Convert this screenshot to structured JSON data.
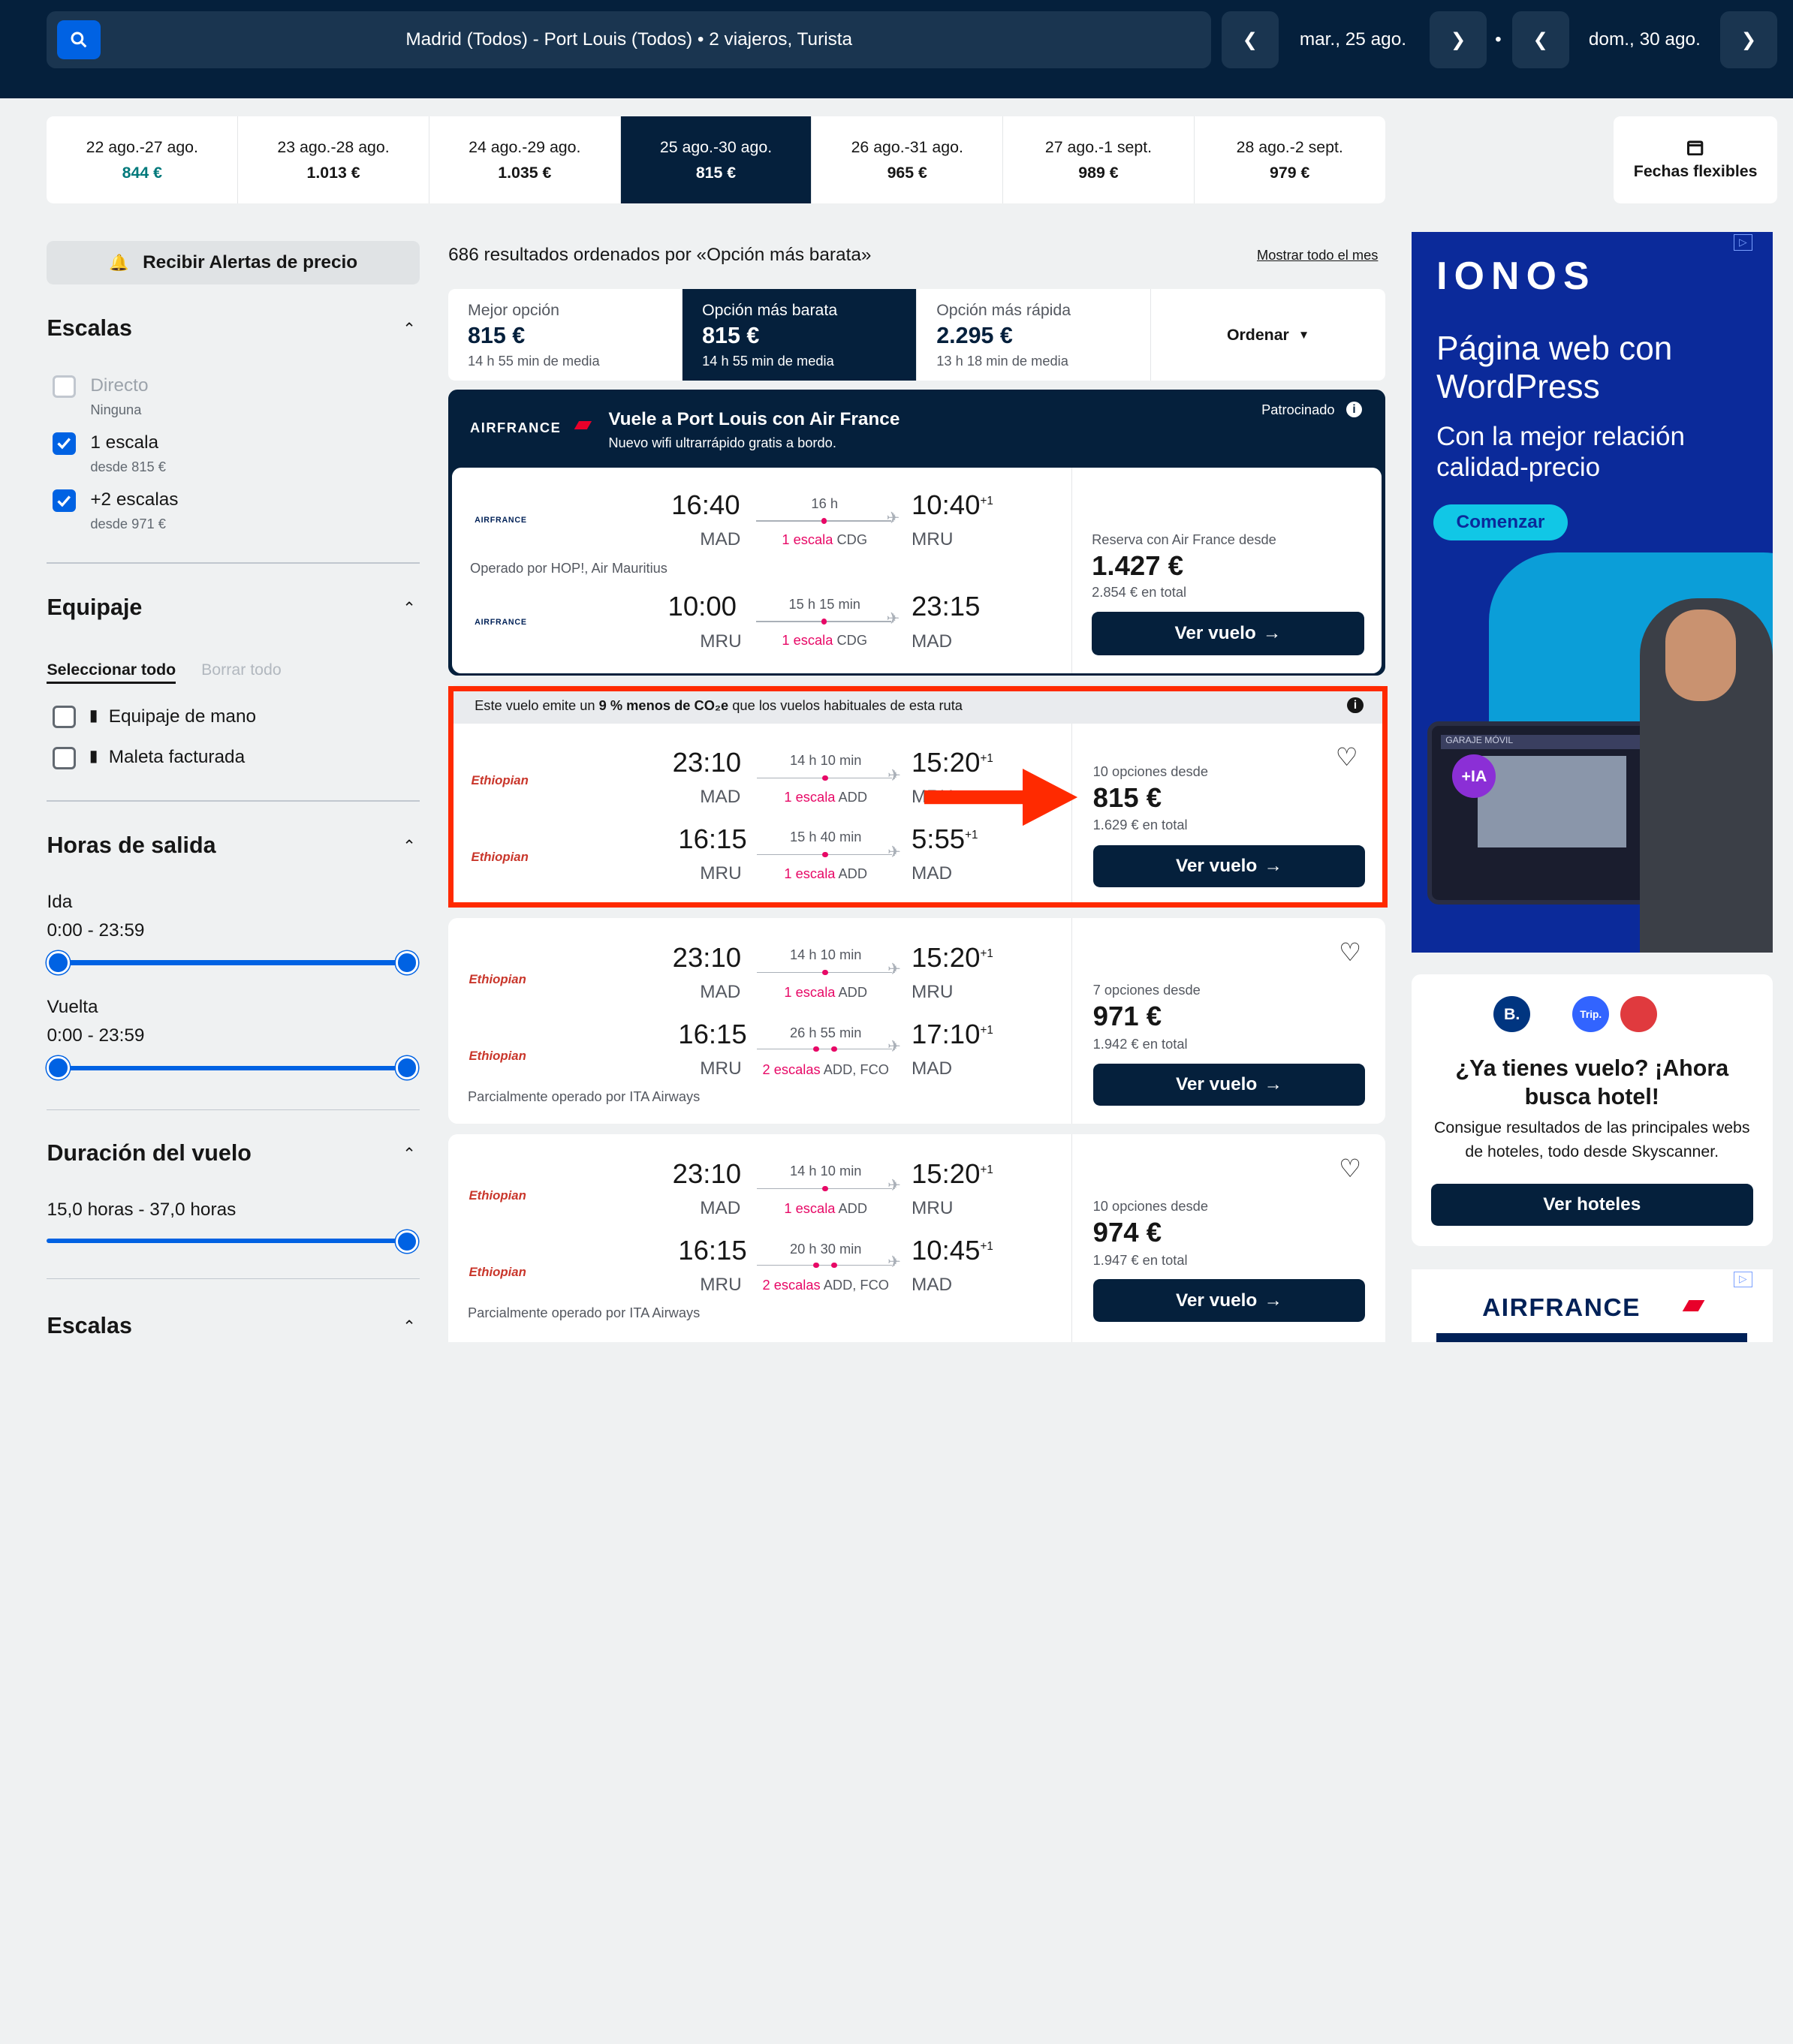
{
  "search": {
    "summary": "Madrid (Todos) - Port Louis (Todos)  •  2 viajeros, Turista",
    "depart": "mar., 25 ago.",
    "return": "dom., 30 ago.",
    "sep": "•"
  },
  "dates": [
    {
      "range": "22 ago.-27 ago.",
      "price": "844 €"
    },
    {
      "range": "23 ago.-28 ago.",
      "price": "1.013 €"
    },
    {
      "range": "24 ago.-29 ago.",
      "price": "1.035 €"
    },
    {
      "range": "25 ago.-30 ago.",
      "price": "815 €"
    },
    {
      "range": "26 ago.-31 ago.",
      "price": "965 €"
    },
    {
      "range": "27 ago.-1 sept.",
      "price": "989 €"
    },
    {
      "range": "28 ago.-2 sept.",
      "price": "979 €"
    }
  ],
  "flex_label": "Fechas flexibles",
  "sidebar": {
    "alert_label": "Recibir Alertas de precio",
    "stops_title": "Escalas",
    "stops": [
      {
        "label": "Directo",
        "sub": "Ninguna"
      },
      {
        "label": "1 escala",
        "sub": "desde 815 €"
      },
      {
        "label": "+2 escalas",
        "sub": "desde 971 €"
      }
    ],
    "bag_title": "Equipaje",
    "select_all": "Seleccionar todo",
    "clear_all": "Borrar todo",
    "bags": [
      "Equipaje de mano",
      "Maleta facturada"
    ],
    "times_title": "Horas de salida",
    "ida": "Ida",
    "ida_range": "0:00 - 23:59",
    "vuelta": "Vuelta",
    "vuelta_range": "0:00 - 23:59",
    "duration_title": "Duración del vuelo",
    "duration_range": "15,0 horas - 37,0 horas",
    "stops2_title": "Escalas"
  },
  "results": {
    "count_text": "686 resultados ordenados por «Opción más barata»",
    "show_month": "Mostrar todo el mes"
  },
  "sort": [
    {
      "title": "Mejor opción",
      "price": "815 €",
      "avg": "14 h 55 min de media"
    },
    {
      "title": "Opción más barata",
      "price": "815 €",
      "avg": "14 h 55 min de media"
    },
    {
      "title": "Opción más rápida",
      "price": "2.295 €",
      "avg": "13 h 18 min de media"
    }
  ],
  "sort_label": "Ordenar",
  "sponsored": {
    "brand": "AIRFRANCE",
    "title": "Vuele a Port Louis con Air France",
    "subtitle": "Nuevo wifi ultrarrápido gratis a bordo.",
    "tag": "Patrocinado",
    "out": {
      "dep": "16:40",
      "dep_ap": "MAD",
      "dur": "16 h",
      "stop": "1 escala",
      "stop_ap": "CDG",
      "arr": "10:40",
      "plus": "+1",
      "arr_ap": "MRU"
    },
    "operated": "Operado por HOP!, Air Mauritius",
    "ret": {
      "dep": "10:00",
      "dep_ap": "MRU",
      "dur": "15 h 15 min",
      "stop": "1 escala",
      "stop_ap": "CDG",
      "arr": "23:15",
      "plus": "",
      "arr_ap": "MAD"
    },
    "from_text": "Reserva con Air France desde",
    "price": "1.427 €",
    "total": "2.854 € en total",
    "btn": "Ver vuelo"
  },
  "eco": {
    "pre": "Este vuelo emite un ",
    "bold": "9 % menos de CO₂e",
    "post": " que los vuelos habituales de esta ruta"
  },
  "flights": [
    {
      "airline": "Ethiopian",
      "out": {
        "dep": "23:10",
        "dep_ap": "MAD",
        "dur": "14 h 10 min",
        "stop": "1 escala",
        "stop_ap": "ADD",
        "arr": "15:20",
        "plus": "+1",
        "arr_ap": "MRU"
      },
      "ret": {
        "dep": "16:15",
        "dep_ap": "MRU",
        "dur": "15 h 40 min",
        "stop": "1 escala",
        "stop_ap": "ADD",
        "arr": "5:55",
        "plus": "+1",
        "arr_ap": "MAD"
      },
      "operated": "",
      "options": "10 opciones desde",
      "price": "815 €",
      "total": "1.629 € en total",
      "btn": "Ver vuelo"
    },
    {
      "airline": "Ethiopian",
      "out": {
        "dep": "23:10",
        "dep_ap": "MAD",
        "dur": "14 h 10 min",
        "stop": "1 escala",
        "stop_ap": "ADD",
        "arr": "15:20",
        "plus": "+1",
        "arr_ap": "MRU"
      },
      "ret": {
        "dep": "16:15",
        "dep_ap": "MRU",
        "dur": "26 h 55 min",
        "stop": "2 escalas",
        "stop_ap": "ADD, FCO",
        "arr": "17:10",
        "plus": "+1",
        "arr_ap": "MAD"
      },
      "operated": "Parcialmente operado por ITA Airways",
      "options": "7 opciones desde",
      "price": "971 €",
      "total": "1.942 € en total",
      "btn": "Ver vuelo"
    },
    {
      "airline": "Ethiopian",
      "out": {
        "dep": "23:10",
        "dep_ap": "MAD",
        "dur": "14 h 10 min",
        "stop": "1 escala",
        "stop_ap": "ADD",
        "arr": "15:20",
        "plus": "+1",
        "arr_ap": "MRU"
      },
      "ret": {
        "dep": "16:15",
        "dep_ap": "MRU",
        "dur": "20 h 30 min",
        "stop": "2 escalas",
        "stop_ap": "ADD, FCO",
        "arr": "10:45",
        "plus": "+1",
        "arr_ap": "MAD"
      },
      "operated": "Parcialmente operado por ITA Airways",
      "options": "10 opciones desde",
      "price": "974 €",
      "total": "1.947 € en total",
      "btn": "Ver vuelo"
    }
  ],
  "ad_ionos": {
    "brand": "IONOS",
    "headline": "Página web con WordPress",
    "sub": "Con la mejor relación calidad-precio",
    "cta": "Comenzar",
    "ia": "+IA",
    "screen": "GARAJE MÓVIL"
  },
  "ad_hotel": {
    "title": "¿Ya tienes vuelo? ¡Ahora busca hotel!",
    "body": "Consigue resultados de las principales webs de hoteles, todo desde Skyscanner.",
    "btn": "Ver hoteles",
    "b1": "B.",
    "b2": "Trip."
  },
  "ad_af": {
    "brand": "AIRFRANCE"
  },
  "colors": {
    "navy": "#05203c",
    "blue": "#0062e3",
    "pink": "#e70866",
    "highlight": "#ff2a00"
  }
}
